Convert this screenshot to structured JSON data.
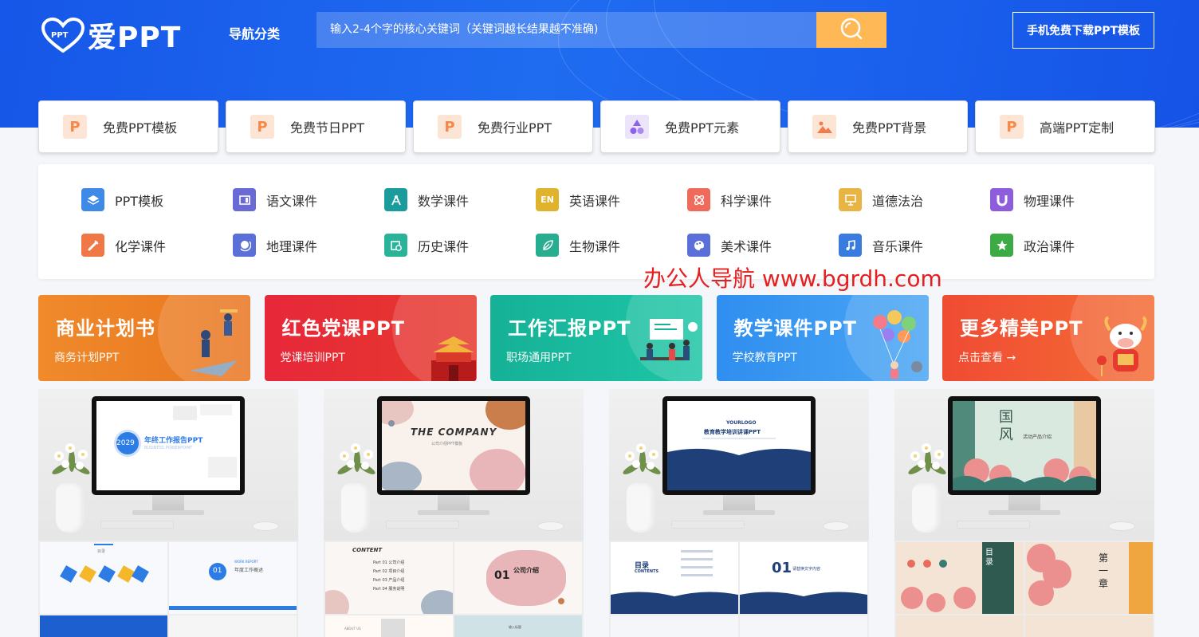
{
  "header": {
    "logo_text": "爱PPT",
    "logo_mark": "PPT",
    "nav_category": "导航分类",
    "search_placeholder": "输入2-4个字的核心关键词（关键词越长结果越不准确)",
    "download_button": "手机免费下载PPT模板"
  },
  "categories": [
    {
      "label": "免费PPT模板",
      "icon": "ppt-icon",
      "glyph": "P",
      "color": "#f5894a",
      "bg": "#fde5d6"
    },
    {
      "label": "免费节日PPT",
      "icon": "ppt-icon",
      "glyph": "P",
      "color": "#f5894a",
      "bg": "#fde5d6"
    },
    {
      "label": "免费行业PPT",
      "icon": "ppt-icon",
      "glyph": "P",
      "color": "#f5894a",
      "bg": "#fde5d6"
    },
    {
      "label": "免费PPT元素",
      "icon": "shapes-icon",
      "glyph": "",
      "color": "#8b63e8",
      "bg": "#ece4fb"
    },
    {
      "label": "免费PPT背景",
      "icon": "image-icon",
      "glyph": "",
      "color": "#f07d50",
      "bg": "#fde5d6"
    },
    {
      "label": "高端PPT定制",
      "icon": "ppt-icon",
      "glyph": "P",
      "color": "#f5894a",
      "bg": "#fde5d6"
    }
  ],
  "subjects": [
    {
      "label": "PPT模板",
      "icon": "layers-icon",
      "color": "#3e8ae6"
    },
    {
      "label": "语文课件",
      "icon": "book-icon",
      "color": "#6a6ad6"
    },
    {
      "label": "数学课件",
      "icon": "compass-icon",
      "color": "#1b9c9c"
    },
    {
      "label": "英语课件",
      "icon": "en-icon",
      "color": "#e0b32d"
    },
    {
      "label": "科学课件",
      "icon": "atom-icon",
      "color": "#ef6a5b"
    },
    {
      "label": "道德法治",
      "icon": "board-icon",
      "color": "#e8b544"
    },
    {
      "label": "物理课件",
      "icon": "magnet-icon",
      "color": "#8d5ddc"
    },
    {
      "label": "化学课件",
      "icon": "flask-icon",
      "color": "#f07846"
    },
    {
      "label": "地理课件",
      "icon": "globe-icon",
      "color": "#5a6fd8"
    },
    {
      "label": "历史课件",
      "icon": "history-icon",
      "color": "#2bb39a"
    },
    {
      "label": "生物课件",
      "icon": "leaf-icon",
      "color": "#27ad8f"
    },
    {
      "label": "美术课件",
      "icon": "palette-icon",
      "color": "#5a6fd8"
    },
    {
      "label": "音乐课件",
      "icon": "music-icon",
      "color": "#3a7be0"
    },
    {
      "label": "政治课件",
      "icon": "star-icon",
      "color": "#3caa45"
    }
  ],
  "watermark": "办公人导航  www.bgrdh.com",
  "banners": [
    {
      "title": "商业计划书",
      "subtitle": "商务计划PPT",
      "bg": "linear-gradient(90deg,#f08a2b,#e8751f)"
    },
    {
      "title": "红色党课PPT",
      "subtitle": "党课培训PPT",
      "bg": "linear-gradient(90deg,#e7273a,#e53a2d)"
    },
    {
      "title": "工作汇报PPT",
      "subtitle": "职场通用PPT",
      "bg": "linear-gradient(90deg,#16b197,#1ec6a6)"
    },
    {
      "title": "教学课件PPT",
      "subtitle": "学校教育PPT",
      "bg": "linear-gradient(90deg,#2f8ef0,#4aa6f3)"
    },
    {
      "title": "更多精美PPT",
      "subtitle": "点击查看 →",
      "bg": "linear-gradient(90deg,#f04b33,#f46d35)"
    }
  ],
  "thumbs": [
    {
      "screen_title": "年终工作报告PPT",
      "screen_sub": "BUSINESS POWERPOINT",
      "screen_year": "2029",
      "slides": [
        "目录",
        "01",
        "年度工作概述",
        "WORK REPORT"
      ]
    },
    {
      "screen_title": "THE COMPANY",
      "screen_sub": "公司介绍PPT模板",
      "slides": [
        "CONTENT",
        "Part 01 公司介绍",
        "Part 02 项目介绍",
        "Part 03 产品介绍",
        "Part 04 服务说明",
        "01",
        "公司介绍",
        "ABOUT US",
        "输入标题"
      ]
    },
    {
      "screen_title": "教育教学培训讲课PPT",
      "screen_sub": "YOURLOGO",
      "slides": [
        "目录",
        "CONTENTS",
        "01",
        "请替换文字内容"
      ]
    },
    {
      "screen_title": "国风",
      "screen_sub": "活动产品介绍",
      "slides": [
        "目录",
        "第一章"
      ]
    }
  ]
}
